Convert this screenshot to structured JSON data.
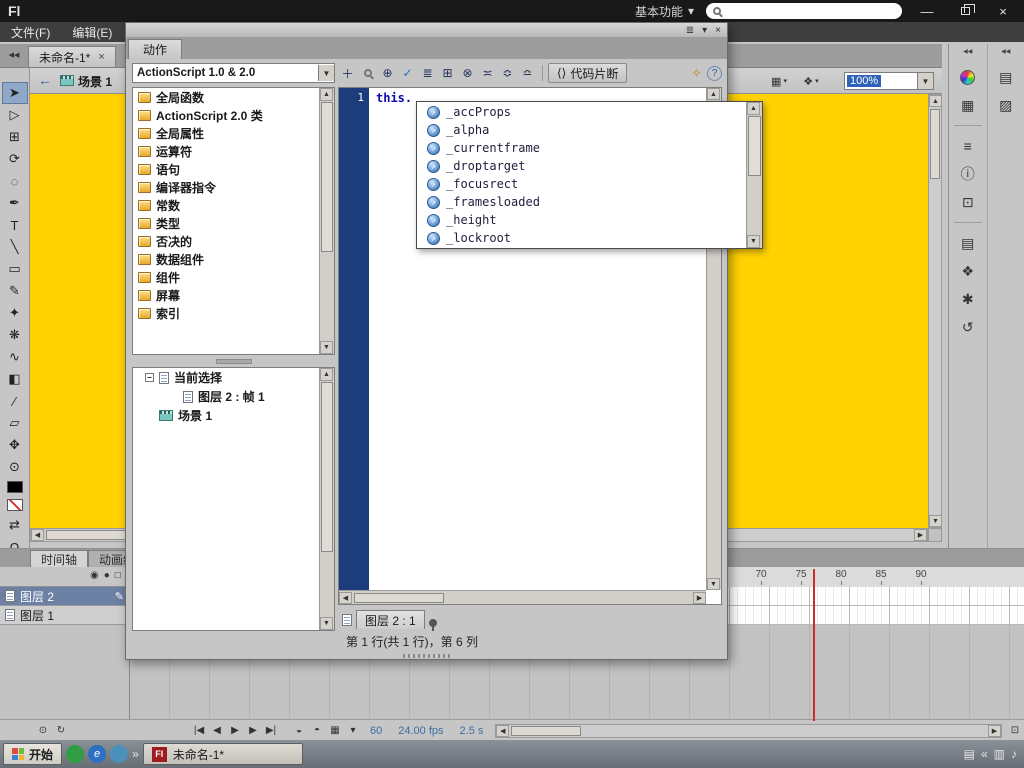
{
  "titlebar": {
    "logo": "Fl",
    "workspace_switcher": "基本功能",
    "search_value": "",
    "minimize_label": "—",
    "close_label": "×"
  },
  "menubar": {
    "file": "文件(F)",
    "edit": "编辑(E)"
  },
  "docbar": {
    "tab_title": "未命名-1*",
    "tab_close": "×"
  },
  "editbar": {
    "scene_label": "场景 1",
    "zoom_value": "100%"
  },
  "actions_panel": {
    "title": "动作",
    "language": "ActionScript 1.0 & 2.0",
    "categories": [
      "全局函数",
      "ActionScript 2.0 类",
      "全局属性",
      "运算符",
      "语句",
      "编译器指令",
      "常数",
      "类型",
      "否决的",
      "数据组件",
      "组件",
      "屏幕",
      "索引"
    ],
    "selection": {
      "root": "当前选择",
      "frame": "图层 2 : 帧 1",
      "scene": "场景 1"
    },
    "snippets_label": "代码片断",
    "line_number": "1",
    "code_text": "this.",
    "code_hints": [
      "_accProps",
      "_alpha",
      "_currentframe",
      "_droptarget",
      "_focusrect",
      "_framesloaded",
      "_height",
      "_lockroot"
    ],
    "script_tab": "图层 2 : 1",
    "status": "第 1 行(共 1 行)，第 6 列"
  },
  "timeline": {
    "tab_timeline": "时间轴",
    "tab_motion_editor": "动画编辑器",
    "layer2": "图层 2",
    "layer1": "图层 1",
    "ruler": [
      "70",
      "75",
      "80",
      "85",
      "90"
    ],
    "current_frame": "60",
    "frame_rate": "24.00 fps",
    "elapsed_time": "2.5 s"
  },
  "taskbar": {
    "start_label": "开始",
    "task_logo": "Fl",
    "task_title": "未命名-1*"
  },
  "icons": {
    "collapse_left": "◀◀",
    "dropdown_arrow": "▼",
    "back_arrow": "←",
    "panel_menu": "▾",
    "panel_options": "≣",
    "close": "×",
    "minus": "−",
    "selection_tool": "➤",
    "subselection_tool": "▷",
    "free_transform_tool": "⊞",
    "rotate_3d_tool": "⟳",
    "lasso_tool": "◌",
    "pen_tool": "✒",
    "text_tool": "T",
    "line_tool": "╲",
    "rectangle_tool": "▭",
    "pencil_tool": "✎",
    "brush_tool": "✦",
    "deco_tool": "❋",
    "bone_tool": "∿",
    "paint_bucket_tool": "◧",
    "eyedropper_tool": "∕",
    "eraser_tool": "▱",
    "hand_tool": "✥",
    "zoom_tool": "⊙",
    "swap_colors": "⇄",
    "snap_magnet": "Ω",
    "smooth": "◠",
    "straighten": "∟",
    "edit_scene": "▦",
    "edit_symbols": "❖",
    "add_script": "＋",
    "insert_target_path": "⊕",
    "check_syntax": "✓",
    "auto_format": "≣",
    "show_code_hints": "⊞",
    "debug_options": "⊗",
    "collapse_braces": "≍",
    "collapse_selection": "≎",
    "expand_all": "≏",
    "snippets": "⟨⟩",
    "script_assist": "✧",
    "help": "?",
    "arrow_up": "▲",
    "arrow_down": "▼",
    "arrow_left": "◀",
    "arrow_right": "▶",
    "property_arrow": "↗",
    "eye": "◉",
    "lock": "●",
    "outline": "□",
    "pencil_edit": "✎",
    "swatches_panel": "▦",
    "align_panel": "≡",
    "info_panel": "ⓘ",
    "transform_panel": "⊡",
    "library_panel": "▤",
    "components_panel": "❖",
    "motion_presets_panel": "✱",
    "history_panel": "↺",
    "properties_panel": "▤",
    "library2_panel": "▨",
    "center_frame": "⊙",
    "onion_skin": "◒",
    "onion_outline": "◓",
    "edit_multiple_frames": "▦",
    "marker_menu": "▾",
    "go_first_frame": "|◀",
    "step_back": "◀",
    "play": "▶",
    "step_forward": "▶",
    "go_last_frame": "▶|",
    "loop": "↻",
    "overflow": "»",
    "tray_input": "▤",
    "tray_collapse": "«",
    "tray_volume": "♪",
    "tray_network": "▥",
    "quick_e": "e"
  }
}
